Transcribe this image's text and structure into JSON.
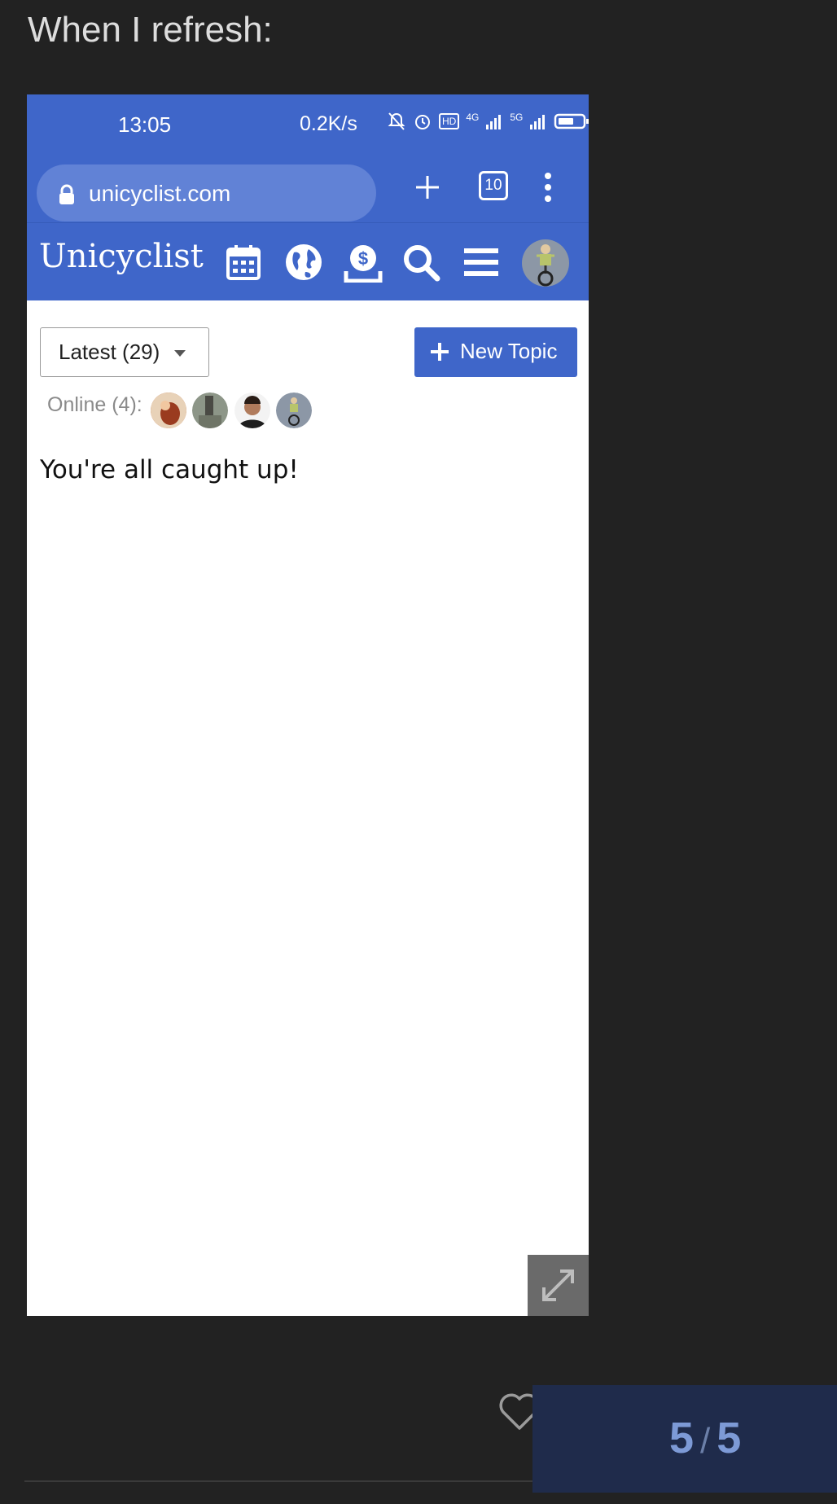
{
  "post": {
    "text": "When I refresh:"
  },
  "phone": {
    "status": {
      "time": "13:05",
      "speed": "0.2K/s",
      "hd_label": "HD",
      "net_4g": "4G",
      "net_5g": "5G"
    },
    "browser": {
      "url": "unicyclist.com",
      "tab_count": "10"
    }
  },
  "site": {
    "logo": "Unicyclist",
    "filter": {
      "label": "Latest (29)"
    },
    "new_topic": {
      "label": "New Topic"
    },
    "online": {
      "label": "Online (4):"
    },
    "message": "You're all caught up!"
  },
  "progress": {
    "current": "5",
    "separator": "/",
    "total": "5"
  },
  "colors": {
    "accent": "#3f66c9",
    "page_bg": "#222222",
    "progress_bg": "#1f2b4b",
    "progress_text": "#7d9ad6"
  },
  "icons": [
    "lock-icon",
    "plus-icon",
    "tabs-icon",
    "more-vert-icon",
    "calendar-icon",
    "globe-icon",
    "donate-icon",
    "search-icon",
    "menu-icon",
    "expand-icon",
    "heart-icon"
  ]
}
